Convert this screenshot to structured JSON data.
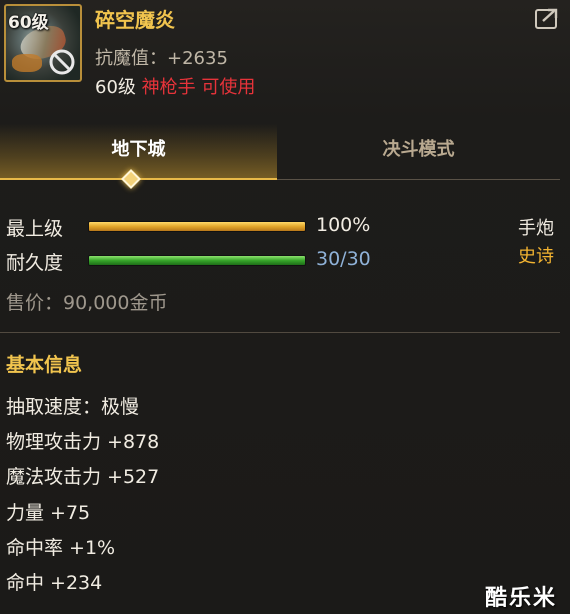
{
  "item": {
    "level_badge": "60级",
    "name": "碎空魔炎",
    "anti_magic": "抗魔值：+2635",
    "req_level": "60级",
    "req_class": "神枪手 可使用",
    "icon": "weapon-art-icon",
    "lock_icon": "no-use-icon",
    "share_icon": "share-icon"
  },
  "tabs": [
    {
      "label": "地下城",
      "active": true
    },
    {
      "label": "决斗模式",
      "active": false
    }
  ],
  "stats": {
    "grade": {
      "label": "最上级",
      "value": "100%",
      "fill": 1.0
    },
    "durability": {
      "label": "耐久度",
      "value": "30/30",
      "fill": 1.0
    }
  },
  "weapon_type": "手炮",
  "rarity": "史诗",
  "price": "售价：90,000金币",
  "basic_info": {
    "title": "基本信息",
    "attributes": [
      "抽取速度：极慢",
      "物理攻击力 +878",
      "魔法攻击力 +527",
      "力量 +75",
      "命中率 +1%",
      "命中 +234"
    ]
  },
  "watermark": "酷乐米",
  "colors": {
    "gold": "#f1c44e",
    "red": "#e7333a",
    "rarity": "#f2b331",
    "bar_orange": "#e2a62a",
    "bar_green": "#37a52a",
    "durability_value": "#8fb2d8"
  }
}
